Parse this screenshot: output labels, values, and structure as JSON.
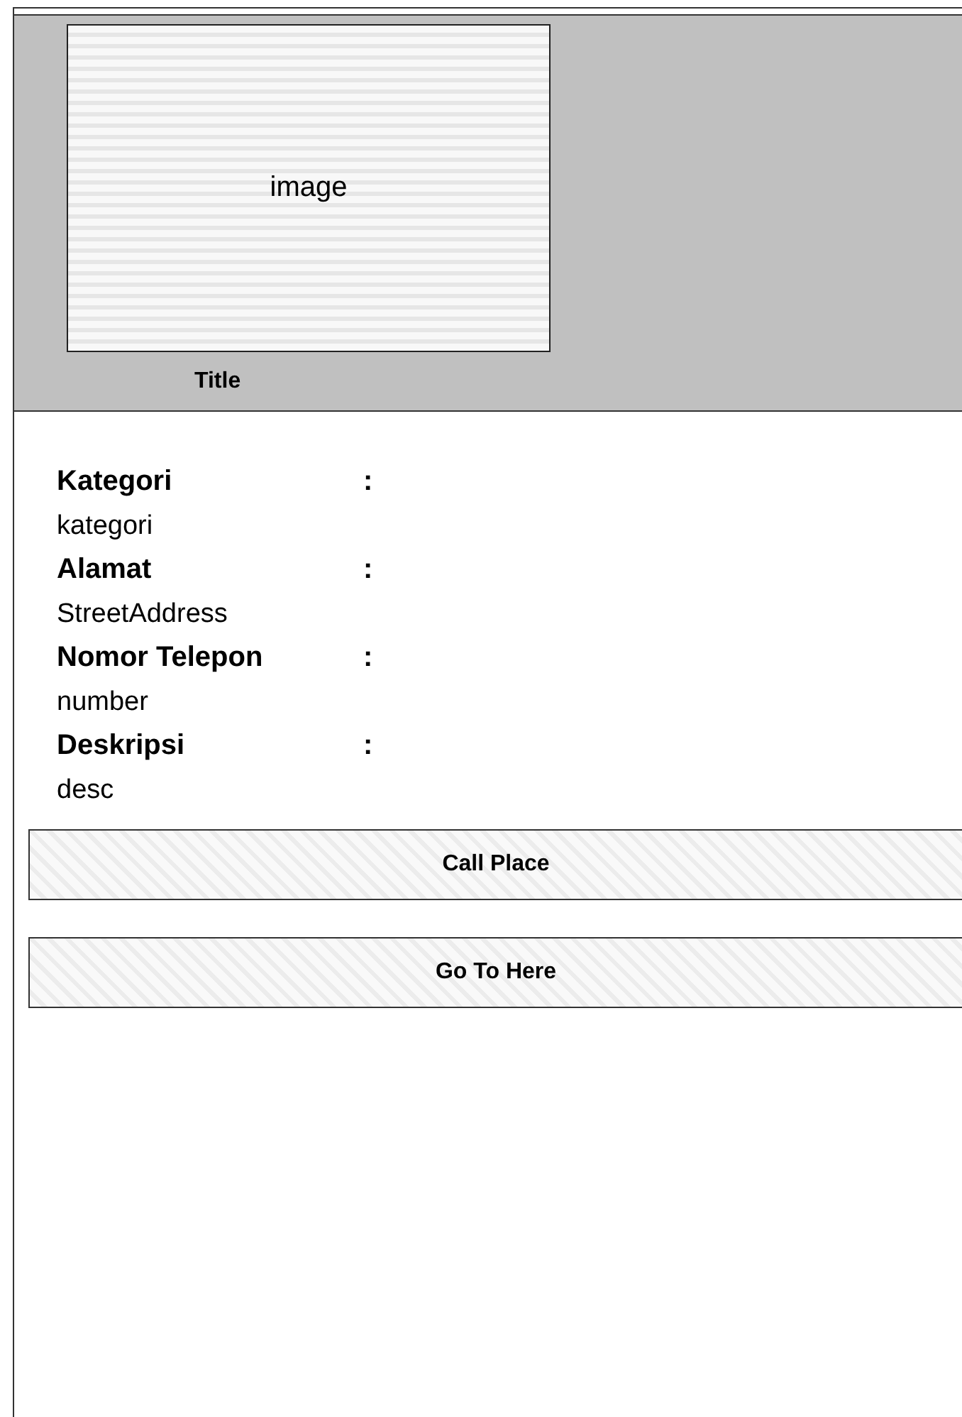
{
  "header": {
    "image_label": "image",
    "title": "Title"
  },
  "details": [
    {
      "label": "Kategori",
      "separator": ":",
      "value": "kategori"
    },
    {
      "label": "Alamat",
      "separator": ":",
      "value": "StreetAddress"
    },
    {
      "label": "Nomor Telepon",
      "separator": ":",
      "value": "number"
    },
    {
      "label": "Deskripsi",
      "separator": ":",
      "value": "desc"
    }
  ],
  "buttons": [
    "Call Place",
    "Go To Here"
  ]
}
